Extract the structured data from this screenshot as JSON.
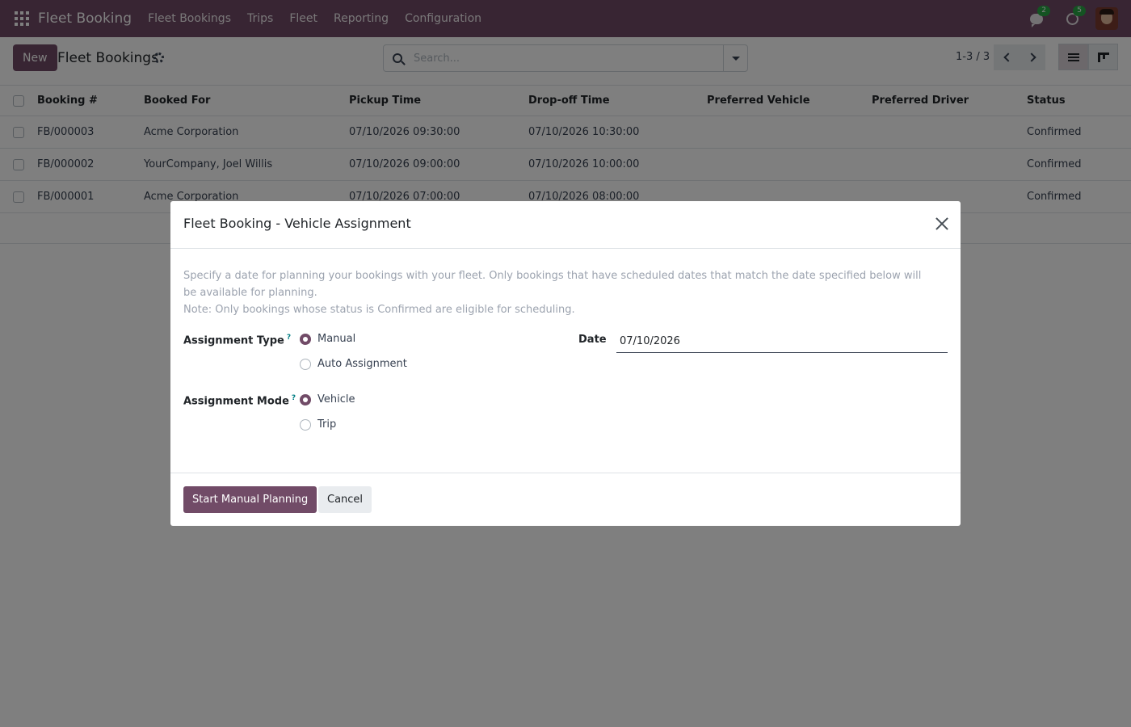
{
  "app": {
    "brand": "Fleet Booking",
    "menu": [
      "Fleet Bookings",
      "Trips",
      "Fleet",
      "Reporting",
      "Configuration"
    ],
    "messages_count": "2",
    "activities_count": "5"
  },
  "control": {
    "new_label": "New",
    "breadcrumb": "Fleet Bookings",
    "search_placeholder": "Search...",
    "pager": "1-3 / 3"
  },
  "table": {
    "columns": [
      "Booking #",
      "Booked For",
      "Pickup Time",
      "Drop-off Time",
      "Preferred Vehicle",
      "Preferred Driver",
      "Status"
    ],
    "rows": [
      {
        "booking": "FB/000003",
        "booked_for": "Acme Corporation",
        "pickup": "07/10/2026 09:30:00",
        "dropoff": "07/10/2026 10:30:00",
        "vehicle": "",
        "driver": "",
        "status": "Confirmed"
      },
      {
        "booking": "FB/000002",
        "booked_for": "YourCompany, Joel Willis",
        "pickup": "07/10/2026 09:00:00",
        "dropoff": "07/10/2026 10:00:00",
        "vehicle": "",
        "driver": "",
        "status": "Confirmed"
      },
      {
        "booking": "FB/000001",
        "booked_for": "Acme Corporation",
        "pickup": "07/10/2026 07:00:00",
        "dropoff": "07/10/2026 08:00:00",
        "vehicle": "",
        "driver": "",
        "status": "Confirmed"
      }
    ]
  },
  "modal": {
    "title": "Fleet Booking - Vehicle Assignment",
    "description_1": "Specify a date for planning your bookings with your fleet. Only bookings that have scheduled dates that match the date specified below will be available for planning.",
    "description_2": "Note: Only bookings whose status is Confirmed are eligible for scheduling.",
    "assignment_type_label": "Assignment Type",
    "assignment_type_options": [
      "Manual",
      "Auto Assignment"
    ],
    "assignment_type_selected": "Manual",
    "assignment_mode_label": "Assignment Mode",
    "assignment_mode_options": [
      "Vehicle",
      "Trip"
    ],
    "assignment_mode_selected": "Vehicle",
    "help_mark": "?",
    "date_label": "Date",
    "date_value": "07/10/2026",
    "primary_button": "Start Manual Planning",
    "cancel_button": "Cancel"
  },
  "colors": {
    "brand": "#714b67",
    "badge": "#28a745"
  }
}
